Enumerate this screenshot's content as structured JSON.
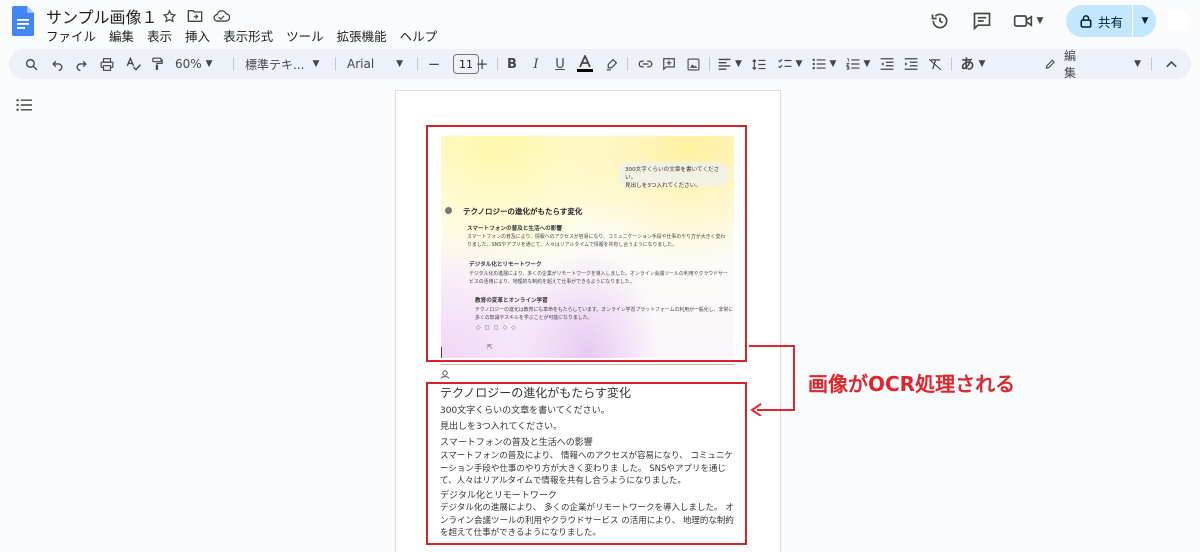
{
  "header": {
    "title": "サンプル画像１",
    "menus": [
      "ファイル",
      "編集",
      "表示",
      "挿入",
      "表示形式",
      "ツール",
      "拡張機能",
      "ヘルプ"
    ],
    "share_label": "共有"
  },
  "toolbar": {
    "zoom": "60%",
    "style": "標準テキ...",
    "font": "Arial",
    "font_size": "11",
    "ime_label": "あ",
    "mode_label": "編集"
  },
  "embedded_image": {
    "bubble_line1": "300文字くらいの文章を書いてください。",
    "bubble_line2": "見出しを3つ入れてください。",
    "heading": "テクノロジーの進化がもたらす変化",
    "sec1_title": "スマートフォンの普及と生活への影響",
    "sec1_body": "スマートフォンの普及により、情報へのアクセスが容易になり、コミュニケーション手段や仕事のやり方が大きく変わりました。SNSやアプリを通じて、人々はリアルタイムで情報を共有し合うようになりました。",
    "sec2_title": "デジタル化とリモートワーク",
    "sec2_body": "デジタル化の進展により、多くの企業がリモートワークを導入しました。オンライン会議ツールの利用やクラウドサービスの活用により、地理的な制約を超えて仕事ができるようになりました。",
    "sec3_title": "教育の変革とオンライン学習",
    "sec3_body": "テクノロジーの進化は教育にも革命をもたらしています。オンライン学習プラットフォームの利用が一般化し、非常に多くの知識やスキルを学ぶことが可能になりました。"
  },
  "ocr_text": {
    "heading": "テクノロジーの進化がもたらす変化",
    "line1": "300文字くらいの文章を書いてください。",
    "line2": "見出しを3つ入れてください。",
    "sub1": "スマートフォンの普及と生活への影響",
    "para1": "スマートフォンの普及により、 情報へのアクセスが容易になり、 コミュニケーション手段や仕事のやり方が大きく変わりま した。 SNSやアプリを通じて、人々はリアルタイムで情報を共有し合うようになりました。",
    "sub2": "デジタル化とリモートワーク",
    "para2": "デジタル化の進展により、 多くの企業がリモートワークを導入しました。 オンライン会議ツールの利用やクラウドサービス の活用により、 地理的な制約を超えて仕事ができるようになりました。"
  },
  "annotation": {
    "label": "画像がOCR処理される"
  },
  "colors": {
    "accent_red": "#e0262d",
    "share_bg": "#c2e7ff",
    "toolbar_bg": "#edf2fa",
    "docs_blue": "#4285f4"
  }
}
